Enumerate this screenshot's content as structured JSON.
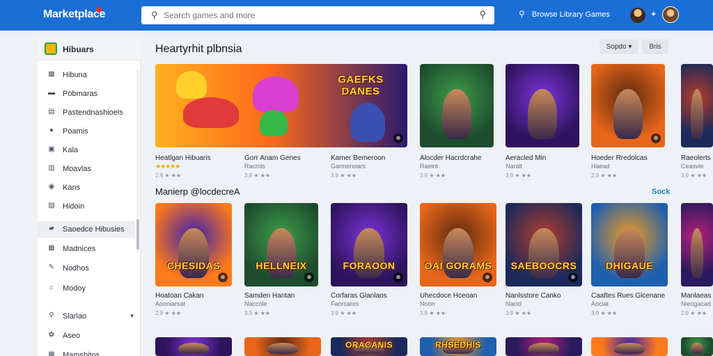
{
  "app": {
    "logo": "Marketplace"
  },
  "search": {
    "placeholder": "Search games and more"
  },
  "header": {
    "browse_label": "Browse Library Games"
  },
  "sidebar": {
    "header": "Hibuars",
    "items": [
      {
        "label": "Hibuna",
        "icon": "grid-icon"
      },
      {
        "label": "Pobmaras",
        "icon": "window-icon"
      },
      {
        "label": "Pastendnashioels",
        "icon": "list-icon"
      },
      {
        "label": "Poamis",
        "icon": "user-icon"
      },
      {
        "label": "Kala",
        "icon": "store-icon"
      },
      {
        "label": "Moavlas",
        "icon": "film-icon"
      },
      {
        "label": "Kans",
        "icon": "globe-icon"
      },
      {
        "label": "Hidoin",
        "icon": "chart-icon"
      },
      {
        "label": "Saoedce Hibusies",
        "icon": "folder-icon"
      },
      {
        "label": "Madnices",
        "icon": "grid-icon"
      },
      {
        "label": "Nodhos",
        "icon": "edit-icon"
      },
      {
        "label": "Modoy",
        "icon": "bank-icon"
      },
      {
        "label": "Slarlao",
        "icon": "search-icon"
      },
      {
        "label": "Aseo",
        "icon": "settings-icon"
      },
      {
        "label": "Mamshitos",
        "icon": "grid-icon"
      }
    ]
  },
  "main": {
    "title": "Heartyrhit plbnsia",
    "sort_label": "Sopdo",
    "filter_label": "Bris",
    "section_title": "Manierp @locdecreA",
    "see_all": "Sock"
  },
  "row1": [
    {
      "name": "Heatlgan Hibuaris",
      "sub": "",
      "meta": "2.9 ★ ★★"
    },
    {
      "name": "Gorr Anam Genes",
      "sub": "Racmis",
      "meta": "3.9 ★ ★★"
    },
    {
      "name": "Kamer Bemeroon",
      "sub": "Garmenoars",
      "meta": "3.9 ★ ★★"
    },
    {
      "name": "Alocder Hacrdcrahe",
      "sub": "Raeint",
      "meta": "3.9 ★ ★★"
    },
    {
      "name": "Aeracled Min",
      "sub": "Naralt",
      "meta": "3.9 ★ ★★"
    },
    {
      "name": "Hoeder Rredolcas",
      "sub": "Haead",
      "meta": "2.9 ★ ★★"
    },
    {
      "name": "Raeolerts",
      "sub": "Ceasvie",
      "meta": "3.9 ★ ★★"
    }
  ],
  "row1_banner_text": "GAEFKS DANES",
  "row2": [
    {
      "name": "Hoatoan Cakan",
      "sub": "Aooniarsat",
      "meta": "2.9 ★ ★★",
      "art": "CHESIDAS"
    },
    {
      "name": "Samden Hantan",
      "sub": "Naccole",
      "meta": "3.9 ★ ★★",
      "art": "HELLNEIX"
    },
    {
      "name": "Corfaras Glanlaos",
      "sub": "Faorcares",
      "meta": "3.9 ★ ★★",
      "art": "FORAOON"
    },
    {
      "name": "Uhecdoce Hceoan",
      "sub": "Noon",
      "meta": "3.9 ★ ★★",
      "art": "OAI GORAMS"
    },
    {
      "name": "Nanlsstore Canko",
      "sub": "Nacid",
      "meta": "3.9 ★ ★★",
      "art": "SAEBOOCRS"
    },
    {
      "name": "Caaftes Rues Glcenane",
      "sub": "Aociat",
      "meta": "3.9 ★ ★★",
      "art": "DHIGAUE"
    },
    {
      "name": "Manlaeas",
      "sub": "Nieogacad",
      "meta": "2.9 ★ ★★",
      "art": ""
    }
  ],
  "row3_art": [
    "",
    "",
    "ORACANIS",
    "RHSEDHIS",
    "",
    "",
    ""
  ],
  "colors": {
    "topbar": "#1b6ed6",
    "accent": "#1b8ab5",
    "stars": "#f2a900"
  }
}
